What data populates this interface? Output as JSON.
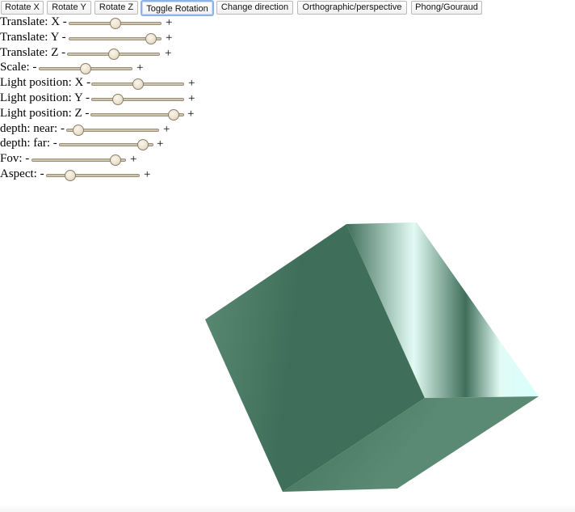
{
  "toolbar": {
    "buttons": [
      {
        "label": "Rotate X"
      },
      {
        "label": "Rotate Y"
      },
      {
        "label": "Rotate Z"
      },
      {
        "label": "Toggle Rotation"
      },
      {
        "label": "Change direction"
      },
      {
        "label": "Orthographic/perspective"
      },
      {
        "label": "Phong/Gouraud"
      }
    ]
  },
  "sliders": [
    {
      "label": "Translate: X -",
      "plus": "+",
      "value": 0.5
    },
    {
      "label": "Translate: Y -",
      "plus": "+",
      "value": 0.95
    },
    {
      "label": "Translate: Z -",
      "plus": "+",
      "value": 0.5
    },
    {
      "label": "Scale: -",
      "plus": "+",
      "value": 0.5
    },
    {
      "label": "Light position: X -",
      "plus": "+",
      "value": 0.5
    },
    {
      "label": "Light position: Y -",
      "plus": "+",
      "value": 0.25
    },
    {
      "label": "Light position: Z -",
      "plus": "+",
      "value": 0.95
    },
    {
      "label": "depth: near: -",
      "plus": "+",
      "value": 0.07
    },
    {
      "label": "depth: far: -",
      "plus": "+",
      "value": 0.95
    },
    {
      "label": "Fov: -",
      "plus": "+",
      "value": 0.95
    },
    {
      "label": "Aspect: -",
      "plus": "+",
      "value": 0.22
    }
  ],
  "colors": {
    "cube_dark": "#3f6e5a",
    "cube_mid": "#5b8a74",
    "cube_light": "#e2fbf4",
    "cube_highlight": "#d8fffd"
  }
}
